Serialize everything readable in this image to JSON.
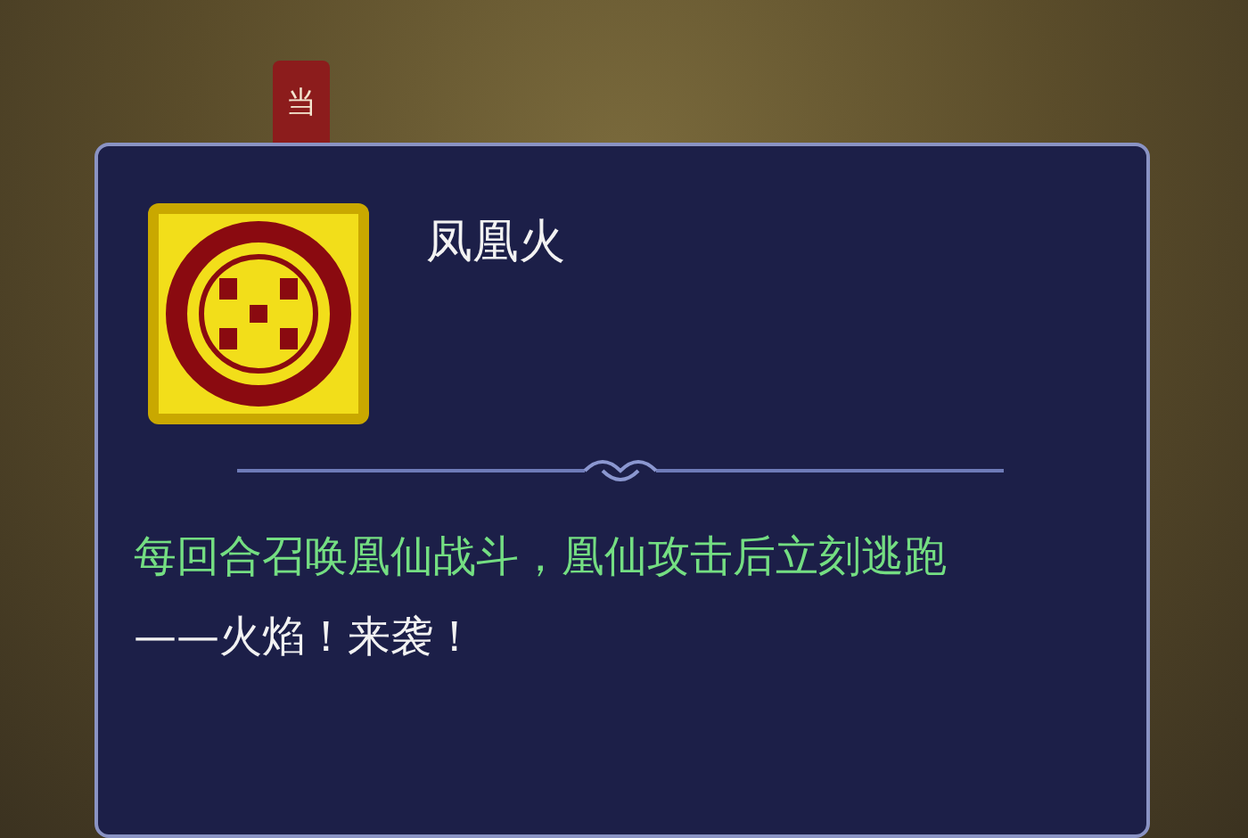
{
  "background": {
    "tab_label": "当"
  },
  "skill": {
    "name": "凤凰火",
    "description": "每回合召唤凰仙战斗，凰仙攻击后立刻逃跑",
    "quote": "——火焰！来袭！"
  }
}
